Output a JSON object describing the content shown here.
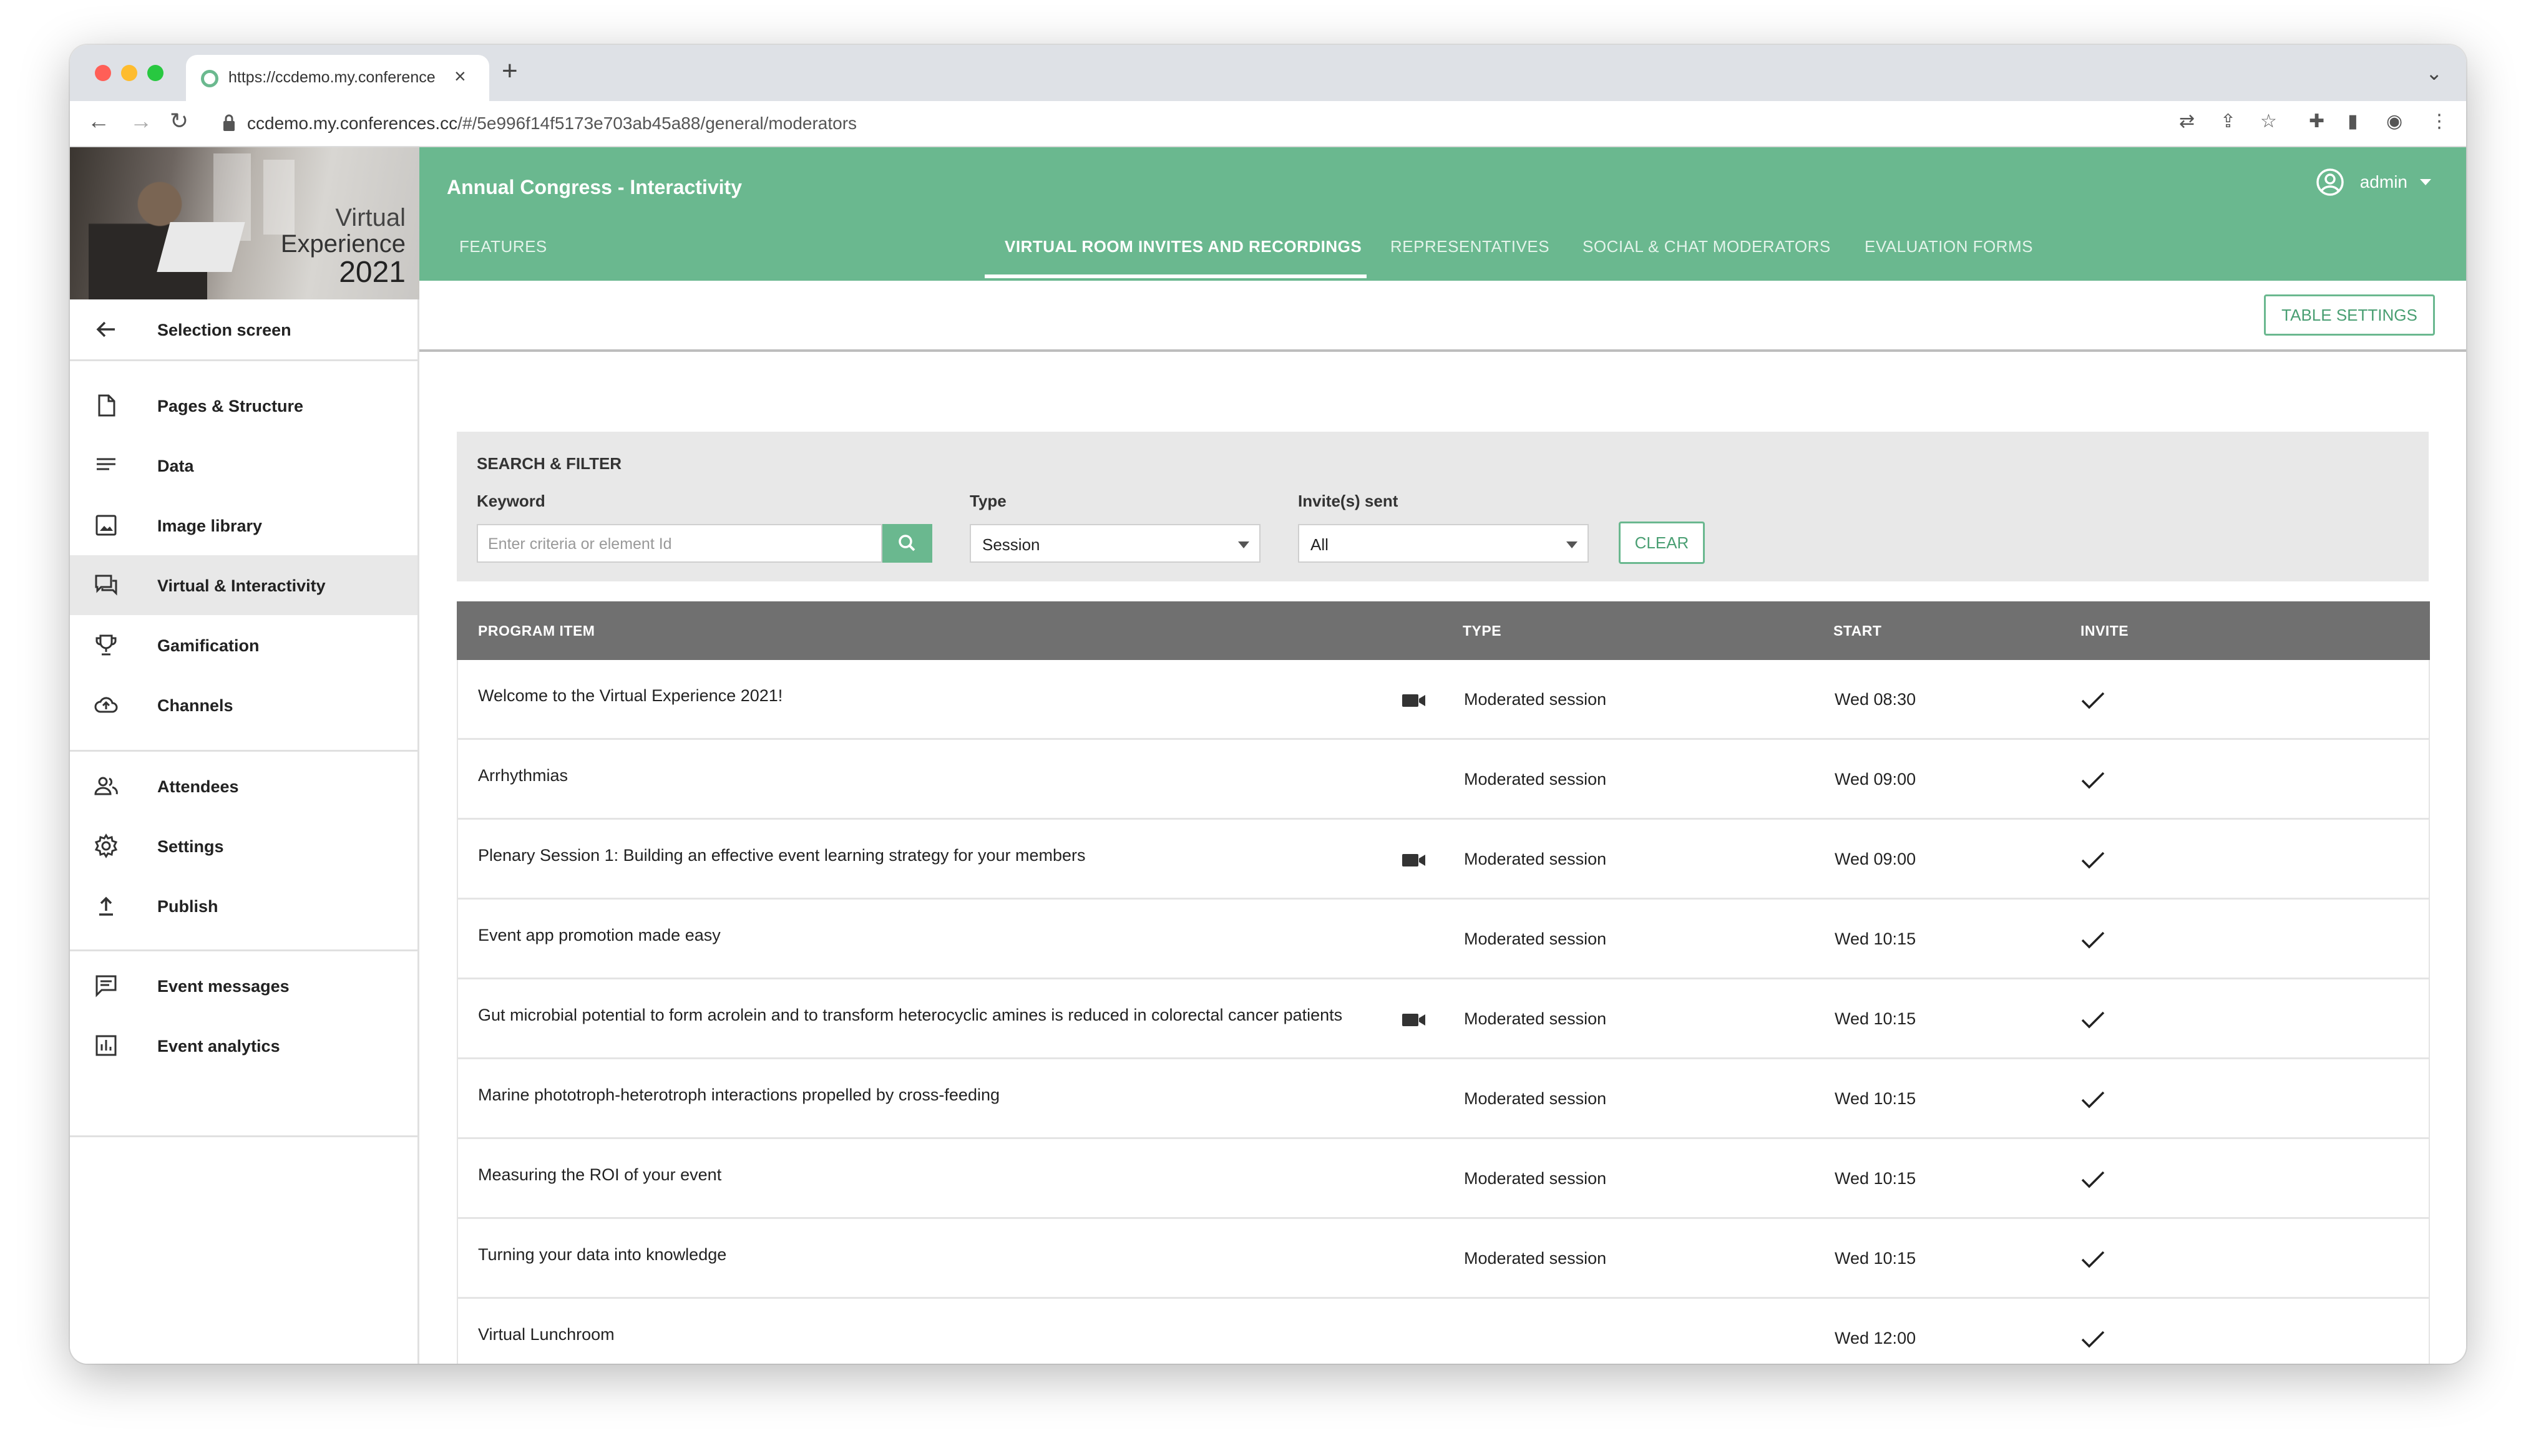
{
  "browser": {
    "tab_title": "https://ccdemo.my.conference",
    "tab_close": "×",
    "new_tab": "+",
    "url_host": "ccdemo.my.conferences.cc",
    "url_path": "/#/5e996f14f5173e703ab45a88/general/moderators"
  },
  "sidebar": {
    "hero": {
      "line1": "Virtual",
      "line2": "Experience",
      "line3": "2021"
    },
    "back_label": "Selection screen",
    "items": [
      {
        "label": "Pages & Structure",
        "icon": "page-icon"
      },
      {
        "label": "Data",
        "icon": "list-icon"
      },
      {
        "label": "Image library",
        "icon": "image-icon"
      },
      {
        "label": "Virtual & Interactivity",
        "icon": "chat-icon",
        "active": true
      },
      {
        "label": "Gamification",
        "icon": "trophy-icon"
      },
      {
        "label": "Channels",
        "icon": "cloud-upload-icon"
      },
      {
        "label": "Attendees",
        "icon": "people-icon"
      },
      {
        "label": "Settings",
        "icon": "gear-icon"
      },
      {
        "label": "Publish",
        "icon": "publish-icon"
      },
      {
        "label": "Event messages",
        "icon": "message-icon"
      },
      {
        "label": "Event analytics",
        "icon": "analytics-icon"
      }
    ]
  },
  "header": {
    "title": "Annual Congress - Interactivity",
    "user": "admin",
    "tabs": [
      {
        "label": "FEATURES"
      },
      {
        "label": "VIRTUAL ROOM INVITES AND RECORDINGS",
        "active": true
      },
      {
        "label": "REPRESENTATIVES"
      },
      {
        "label": "SOCIAL & CHAT MODERATORS"
      },
      {
        "label": "EVALUATION FORMS"
      }
    ]
  },
  "actions": {
    "table_settings": "TABLE SETTINGS"
  },
  "filter": {
    "title": "SEARCH & FILTER",
    "keyword_label": "Keyword",
    "keyword_placeholder": "Enter criteria or element Id",
    "type_label": "Type",
    "type_value": "Session",
    "invites_label": "Invite(s) sent",
    "invites_value": "All",
    "clear": "CLEAR"
  },
  "table": {
    "headers": {
      "item": "PROGRAM ITEM",
      "type": "TYPE",
      "start": "START",
      "invite": "INVITE"
    },
    "rows": [
      {
        "item": "Welcome to the Virtual Experience 2021!",
        "camera": true,
        "type": "Moderated session",
        "start": "Wed 08:30",
        "invite": true
      },
      {
        "item": "Arrhythmias",
        "camera": false,
        "type": "Moderated session",
        "start": "Wed 09:00",
        "invite": true
      },
      {
        "item": "Plenary Session 1: Building an effective event learning strategy for your members",
        "camera": true,
        "type": "Moderated session",
        "start": "Wed 09:00",
        "invite": true
      },
      {
        "item": "Event app promotion made easy",
        "camera": false,
        "type": "Moderated session",
        "start": "Wed 10:15",
        "invite": true
      },
      {
        "item": "Gut microbial potential to form acrolein and to transform heterocyclic amines is reduced in colorectal cancer patients",
        "camera": true,
        "type": "Moderated session",
        "start": "Wed 10:15",
        "invite": true
      },
      {
        "item": "Marine phototroph-heterotroph interactions propelled by cross-feeding",
        "camera": false,
        "type": "Moderated session",
        "start": "Wed 10:15",
        "invite": true
      },
      {
        "item": "Measuring the ROI of your event",
        "camera": false,
        "type": "Moderated session",
        "start": "Wed 10:15",
        "invite": true
      },
      {
        "item": "Turning your data into knowledge",
        "camera": false,
        "type": "Moderated session",
        "start": "Wed 10:15",
        "invite": true
      },
      {
        "item": "Virtual Lunchroom",
        "camera": false,
        "type": "",
        "start": "Wed 12:00",
        "invite": true
      }
    ]
  },
  "colors": {
    "accent": "#6ab88f",
    "table_header": "#707070",
    "active_item": "#e8e8e8"
  }
}
